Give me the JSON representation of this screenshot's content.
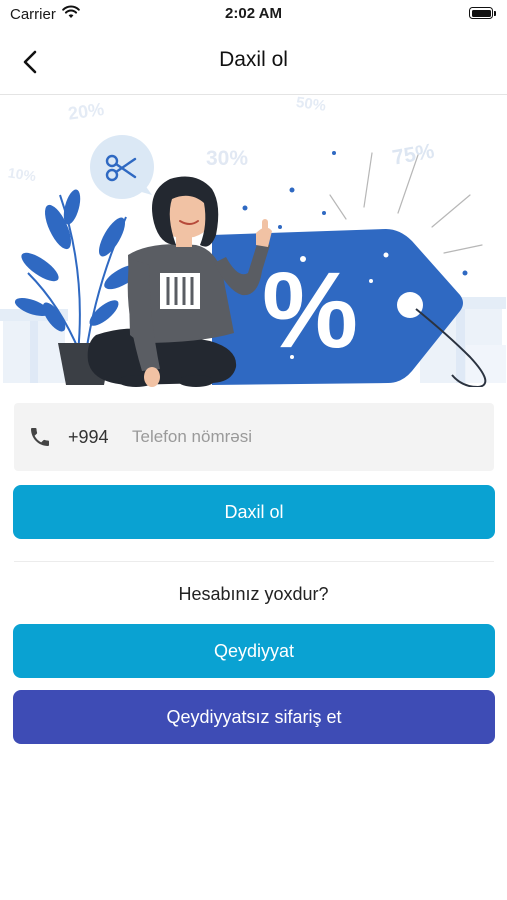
{
  "status_bar": {
    "carrier": "Carrier",
    "time": "2:02 AM"
  },
  "nav": {
    "title": "Daxil ol",
    "back_icon": "chevron-left-icon"
  },
  "hero": {
    "badges": [
      "20%",
      "50%",
      "30%",
      "75%",
      "10%"
    ],
    "tag_symbol": "%",
    "bubble_icon": "scissors-icon"
  },
  "form": {
    "phone_icon": "phone-icon",
    "prefix": "+994",
    "phone_value": "",
    "phone_placeholder": "Telefon nömrəsi",
    "login_label": "Daxil ol"
  },
  "register": {
    "prompt": "Hesabınız yoxdur?",
    "register_label": "Qeydiyyat",
    "guest_order_label": "Qeydiyyatsız sifariş et"
  },
  "colors": {
    "primary": "#0aa2d2",
    "secondary": "#3e4cb5",
    "tag": "#2f69c2"
  }
}
